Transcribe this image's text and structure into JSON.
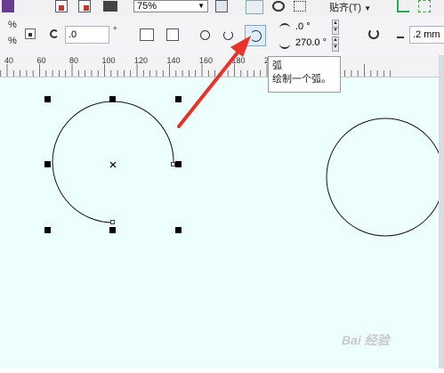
{
  "top_toolbar": {
    "zoom_value": "75%",
    "snap_label": "贴齐(T)"
  },
  "property_bar": {
    "percent_top": "%",
    "percent_bottom": "%",
    "rotation_value": ".0",
    "rotation_unit": "°",
    "start_angle": ".0 °",
    "end_angle": "270.0 °",
    "outline_width": ".2 mm"
  },
  "ruler": {
    "labels": [
      "40",
      "60",
      "80",
      "100",
      "120",
      "140",
      "160",
      "180",
      "200"
    ]
  },
  "tooltip": {
    "title": "弧",
    "description": "绘制一个弧。"
  },
  "watermark": "Bai 经验",
  "colors": {
    "canvas": "#edfffd",
    "arrow": "#e8322a",
    "selection_handles": "#000000"
  },
  "icons": {
    "arc_tool": "arc-icon",
    "ellipse_tool": "ellipse-icon",
    "pie_tool": "pie-icon"
  }
}
